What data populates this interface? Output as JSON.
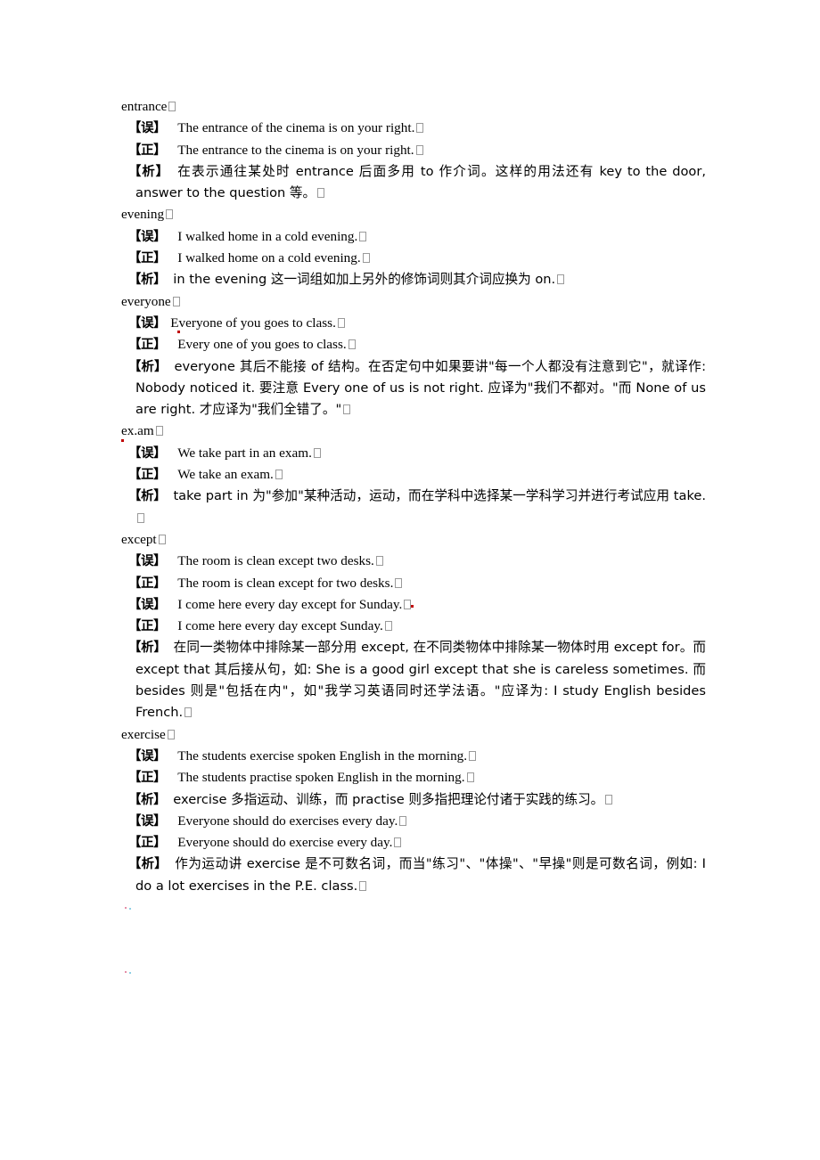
{
  "document": {
    "type": "english-usage-notes",
    "language_mix": "chinese-english",
    "markers": {
      "wrong": "【误】",
      "correct": "【正】",
      "analysis": "【析】"
    },
    "entries": [
      {
        "headword": "entrance",
        "lines": [
          {
            "marker": "【误】",
            "text": "The entrance of the cinema is on your right."
          },
          {
            "marker": "【正】",
            "text": "The entrance to the cinema is on your right."
          },
          {
            "marker": "【析】",
            "text": "在表示通往某处时 entrance 后面多用 to 作介词。这样的用法还有 key to the door, answer to the question 等。"
          }
        ]
      },
      {
        "headword": "evening",
        "lines": [
          {
            "marker": "【误】",
            "text": "I walked home in a cold evening."
          },
          {
            "marker": "【正】",
            "text": "I walked home on a cold evening."
          },
          {
            "marker": "【析】",
            "text": "in the evening 这一词组如加上另外的修饰词则其介词应换为 on."
          }
        ]
      },
      {
        "headword": "everyone",
        "lines": [
          {
            "marker": "【误】",
            "text": "Everyone of you goes to class."
          },
          {
            "marker": "【正】",
            "text": "Every one of you goes to class."
          },
          {
            "marker": "【析】",
            "text": "everyone 其后不能接 of 结构。在否定句中如果要讲\"每一个人都没有注意到它\"，就译作: Nobody noticed it. 要注意 Every one of us is not right. 应译为\"我们不都对。\"而 None of us are right. 才应译为\"我们全错了。\""
          }
        ]
      },
      {
        "headword": "ex.am",
        "lines": [
          {
            "marker": "【误】",
            "text": "We take part in an exam."
          },
          {
            "marker": "【正】",
            "text": "We take an exam."
          },
          {
            "marker": "【析】",
            "text": "take part in 为\"参加\"某种活动，运动，而在学科中选择某一学科学习并进行考试应用 take."
          }
        ]
      },
      {
        "headword": "except",
        "lines": [
          {
            "marker": "【误】",
            "text": "The room is clean except two desks."
          },
          {
            "marker": "【正】",
            "text": "The room is clean except for two desks."
          },
          {
            "marker": "【误】",
            "text": "I come here every day except for Sunday."
          },
          {
            "marker": "【正】",
            "text": "I come here every day except Sunday."
          },
          {
            "marker": "【析】",
            "text": "在同一类物体中排除某一部分用 except, 在不同类物体中排除某一物体时用 except for。而 except that 其后接从句，如: She is a good girl except that she is careless sometimes. 而 besides 则是\"包括在内\"，如\"我学习英语同时还学法语。\"应译为: I study English besides French."
          }
        ]
      },
      {
        "headword": "exercise",
        "lines": [
          {
            "marker": "【误】",
            "text": "The students exercise spoken English in the morning."
          },
          {
            "marker": "【正】",
            "text": "The students practise spoken English in the morning."
          },
          {
            "marker": "【析】",
            "text": "exercise 多指运动、训练，而 practise 则多指把理论付诸于实践的练习。"
          },
          {
            "marker": "【误】",
            "text": "Everyone should do exercises every day."
          },
          {
            "marker": "【正】",
            "text": "Everyone should do exercise every day."
          },
          {
            "marker": "【析】",
            "text": "作为运动讲 exercise 是不可数名词，而当\"练习\"、\"体操\"、\"早操\"则是可数名词，例如: I do a lot exercises in the P.E. class."
          }
        ]
      }
    ]
  },
  "colors": {
    "background": "#ffffff",
    "text": "#000000",
    "spellcheck_mark": "#c00000",
    "tofu_border": "#9a9a9a"
  }
}
